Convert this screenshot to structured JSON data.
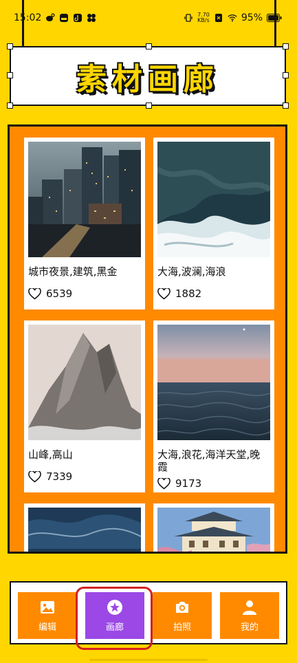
{
  "status_bar": {
    "time": "15:02",
    "net_speed_top": "7.70",
    "net_speed_unit": "KB/s",
    "battery": "95%"
  },
  "header": {
    "title": "素材画廊"
  },
  "gallery": {
    "items": [
      {
        "title": "城市夜景,建筑,黑金",
        "likes": "6539",
        "image": "city-night-skyline"
      },
      {
        "title": "大海,波澜,海浪",
        "likes": "1882",
        "image": "ocean-waves-aerial"
      },
      {
        "title": "山峰,高山",
        "likes": "7339",
        "image": "rocky-mountain-peak"
      },
      {
        "title": "大海,浪花,海洋天堂,晚霞",
        "likes": "9173",
        "image": "sea-at-dusk"
      },
      {
        "title": "",
        "likes": "",
        "image": "deep-blue-waves"
      },
      {
        "title": "",
        "likes": "",
        "image": "japanese-castle"
      }
    ]
  },
  "bottom_nav": {
    "items": [
      {
        "label": "编辑",
        "icon": "image-icon"
      },
      {
        "label": "画廊",
        "icon": "gallery-star-icon"
      },
      {
        "label": "拍照",
        "icon": "camera-icon"
      },
      {
        "label": "我的",
        "icon": "person-icon"
      }
    ],
    "active": "画廊"
  },
  "colors": {
    "background": "#FFD600",
    "frame": "#FF8A00",
    "active": "#9B48E6",
    "highlight_ring": "#D42020"
  }
}
